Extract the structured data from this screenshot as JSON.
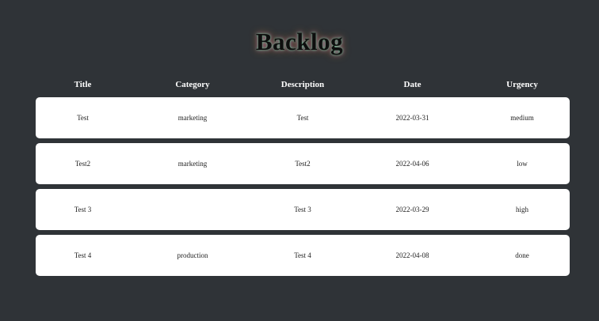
{
  "page": {
    "title": "Backlog"
  },
  "table": {
    "headers": [
      "Title",
      "Category",
      "Description",
      "Date",
      "Urgency"
    ],
    "rows": [
      {
        "title": "Test",
        "category": "marketing",
        "description": "Test",
        "date": "2022-03-31",
        "urgency": "medium"
      },
      {
        "title": "Test2",
        "category": "marketing",
        "description": "Test2",
        "date": "2022-04-06",
        "urgency": "low"
      },
      {
        "title": "Test 3",
        "category": "",
        "description": "Test 3",
        "date": "2022-03-29",
        "urgency": "high"
      },
      {
        "title": "Test 4",
        "category": "production",
        "description": "Test 4",
        "date": "2022-04-08",
        "urgency": "done"
      }
    ]
  },
  "colors": {
    "background": "#2f3337",
    "card": "#ffffff",
    "header_text": "#ffffff",
    "cell_text": "#222222"
  }
}
